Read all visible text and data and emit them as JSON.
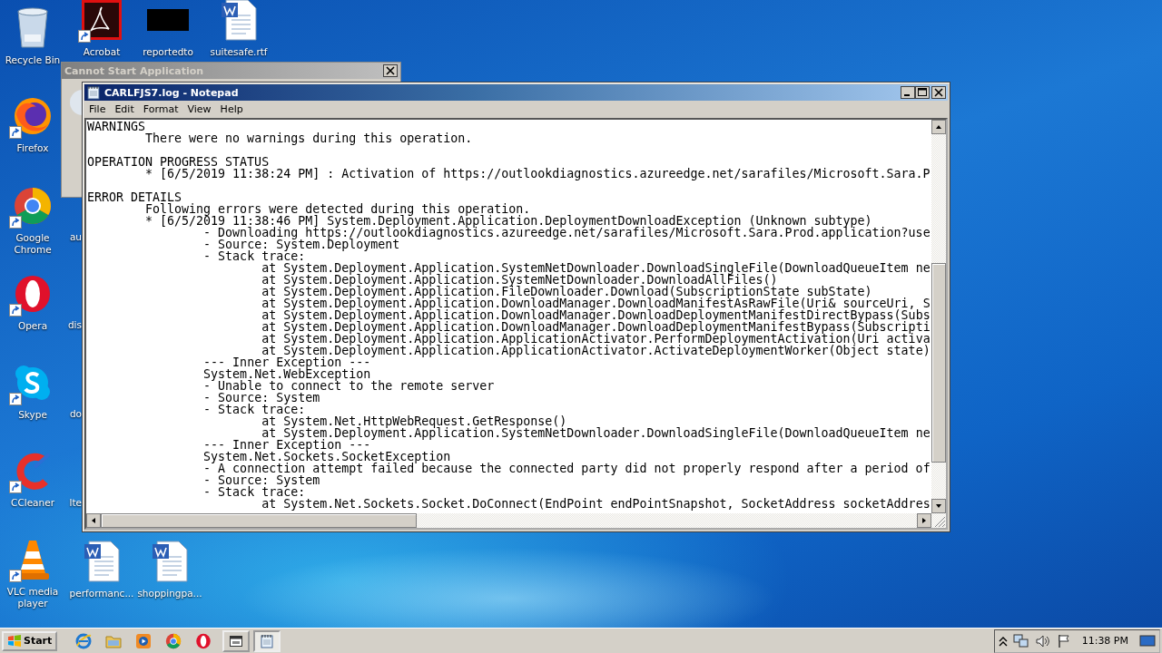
{
  "desktop_icons": [
    {
      "label": "Recycle Bin",
      "kind": "recycle-bin",
      "shortcut": false
    },
    {
      "label": "Firefox",
      "kind": "firefox",
      "shortcut": true
    },
    {
      "label": "Google Chrome",
      "kind": "chrome",
      "shortcut": true
    },
    {
      "label": "Opera",
      "kind": "opera",
      "shortcut": true
    },
    {
      "label": "Skype",
      "kind": "skype",
      "shortcut": true
    },
    {
      "label": "CCleaner",
      "kind": "ccleaner",
      "shortcut": true
    },
    {
      "label": "VLC media player",
      "kind": "vlc",
      "shortcut": true
    },
    {
      "label": "Acrobat",
      "kind": "acrobat",
      "shortcut": true
    },
    {
      "label": "reportedto",
      "kind": "thumbnail",
      "shortcut": false
    },
    {
      "label": "suitesafe.rtf",
      "kind": "document",
      "shortcut": false
    },
    {
      "label": "performanc...",
      "kind": "document",
      "shortcut": false
    },
    {
      "label": "shoppingpa...",
      "kind": "document",
      "shortcut": false
    }
  ],
  "partial_labels": [
    "au",
    "dis",
    "do",
    "lte"
  ],
  "dialog": {
    "title": "Cannot Start Application"
  },
  "notepad": {
    "title": "CARLFJS7.log - Notepad",
    "menu": [
      "File",
      "Edit",
      "Format",
      "View",
      "Help"
    ],
    "sections": [
      [
        "WARNINGS",
        "\tThere were no warnings during this operation."
      ],
      [
        "OPERATION PROGRESS STATUS",
        "\t* [6/5/2019 11:38:24 PM] : Activation of https://outlookdiagnostics.azureedge.net/sarafiles/Microsoft.Sara.P"
      ],
      [
        "ERROR DETAILS",
        "\tFollowing errors were detected during this operation.",
        "\t* [6/5/2019 11:38:46 PM] System.Deployment.Application.DeploymentDownloadException (Unknown subtype)",
        "\t\t- Downloading https://outlookdiagnostics.azureedge.net/sarafiles/Microsoft.Sara.Prod.application?use",
        "\t\t- Source: System.Deployment",
        "\t\t- Stack trace:",
        "\t\t\tat System.Deployment.Application.SystemNetDownloader.DownloadSingleFile(DownloadQueueItem ne",
        "\t\t\tat System.Deployment.Application.SystemNetDownloader.DownloadAllFiles()",
        "\t\t\tat System.Deployment.Application.FileDownloader.Download(SubscriptionState subState)",
        "\t\t\tat System.Deployment.Application.DownloadManager.DownloadManifestAsRawFile(Uri& sourceUri, S",
        "\t\t\tat System.Deployment.Application.DownloadManager.DownloadDeploymentManifestDirectBypass(Subs",
        "\t\t\tat System.Deployment.Application.DownloadManager.DownloadDeploymentManifestBypass(Subscripti",
        "\t\t\tat System.Deployment.Application.ApplicationActivator.PerformDeploymentActivation(Uri activa",
        "\t\t\tat System.Deployment.Application.ApplicationActivator.ActivateDeploymentWorker(Object state)",
        "\t\t--- Inner Exception ---",
        "\t\tSystem.Net.WebException",
        "\t\t- Unable to connect to the remote server",
        "\t\t- Source: System",
        "\t\t- Stack trace:",
        "\t\t\tat System.Net.HttpWebRequest.GetResponse()",
        "\t\t\tat System.Deployment.Application.SystemNetDownloader.DownloadSingleFile(DownloadQueueItem ne",
        "\t\t--- Inner Exception ---",
        "\t\tSystem.Net.Sockets.SocketException",
        "\t\t- A connection attempt failed because the connected party did not properly respond after a period of",
        "\t\t- Source: System",
        "\t\t- Stack trace:",
        "\t\t\tat System.Net.Sockets.Socket.DoConnect(EndPoint endPointSnapshot, SocketAddress socketAddres"
      ]
    ]
  },
  "taskbar": {
    "start_label": "Start",
    "clock": "11:38 PM",
    "tasks": [
      {
        "kind": "app",
        "selected": false
      },
      {
        "kind": "notepad",
        "selected": true
      }
    ]
  }
}
